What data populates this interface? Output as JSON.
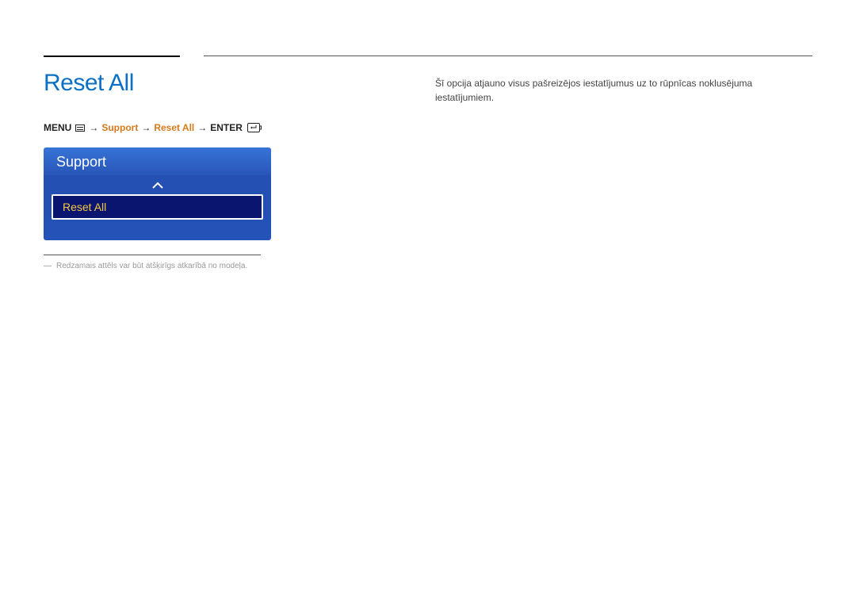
{
  "title": "Reset All",
  "breadcrumb": {
    "menu_label": "MENU",
    "arrow": "→",
    "support": "Support",
    "reset_all": "Reset All",
    "enter_label": "ENTER"
  },
  "osd": {
    "header": "Support",
    "item": "Reset All"
  },
  "footnote": {
    "dash": "―",
    "text": "Redzamais attēls var būt atšķirīgs atkarībā no modeļa."
  },
  "description": "Šī opcija atjauno visus pašreizējos iestatījumus uz to rūpnīcas noklusējuma iestatījumiem."
}
